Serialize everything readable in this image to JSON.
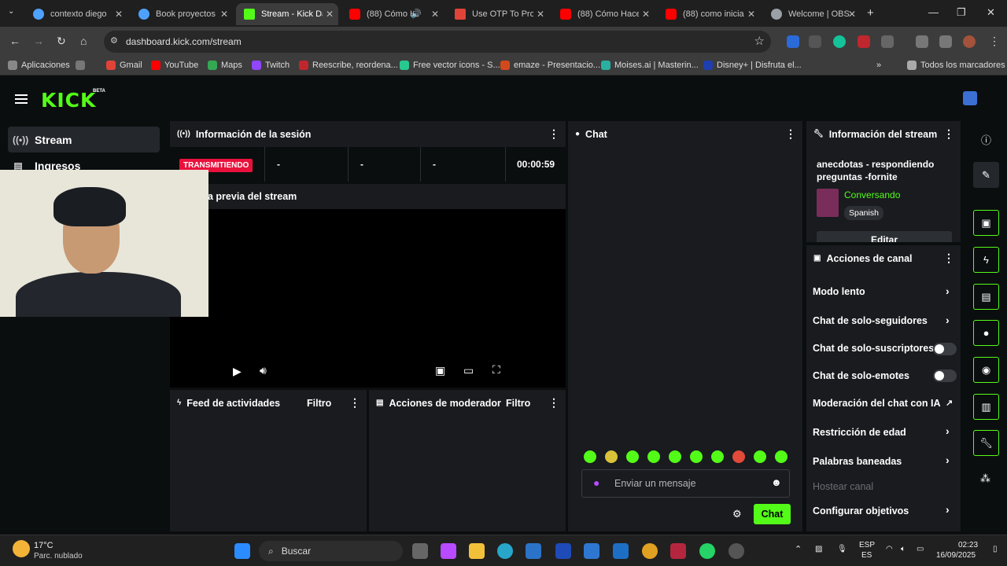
{
  "browser": {
    "tabs": [
      {
        "label": "contexto diego",
        "color": "#4ea1ff"
      },
      {
        "label": "Book proyectos",
        "color": "#4ea1ff"
      },
      {
        "label": "Stream - Kick Da",
        "color": "#53fc18"
      },
      {
        "label": "(88) Cómo H",
        "color": "#ff0000"
      },
      {
        "label": "Use OTP To Proc",
        "color": "#e04438"
      },
      {
        "label": "(88) Cómo Hace",
        "color": "#ff0000"
      },
      {
        "label": "(88) como iniciar",
        "color": "#ff0000"
      },
      {
        "label": "Welcome | OBS",
        "color": "#9aa0a6"
      }
    ],
    "url": "dashboard.kick.com/stream",
    "bookmarks": [
      {
        "label": "Aplicaciones"
      },
      {
        "label": "Gmail"
      },
      {
        "label": "YouTube"
      },
      {
        "label": "Maps"
      },
      {
        "label": "Twitch"
      },
      {
        "label": "Reescribe, reordena..."
      },
      {
        "label": "Free vector icons - S..."
      },
      {
        "label": "emaze - Presentacio..."
      },
      {
        "label": "Moises.ai | Masterin..."
      },
      {
        "label": "Disney+ | Disfruta el..."
      }
    ],
    "all_bookmarks": "Todos los marcadores"
  },
  "app": {
    "logo": "KICK",
    "beta": "BETA",
    "sidebar": [
      {
        "label": "Stream"
      },
      {
        "label": "Ingresos"
      }
    ],
    "session": {
      "title": "Información de la sesión",
      "badge": "TRANSMITIENDO",
      "stat1": "-",
      "stat2": "-",
      "stat3": "-",
      "time": "00:00:59"
    },
    "preview_title": "a previa del stream",
    "feed": {
      "title": "Feed de actividades",
      "filter": "Filtro"
    },
    "modactions": {
      "title": "Acciones de moderador",
      "filter": "Filtro"
    },
    "chat": {
      "title": "Chat",
      "placeholder": "Enviar un mensaje",
      "button": "Chat"
    },
    "stream_info": {
      "title": "Información del stream",
      "stream_title": "anecdotas - respondiendo preguntas -fornite",
      "category": "Conversando",
      "language": "Spanish",
      "edit": "Editar"
    },
    "channel_actions": {
      "title": "Acciones de canal",
      "items": [
        {
          "label": "Modo lento"
        },
        {
          "label": "Chat de solo-seguidores"
        },
        {
          "label": "Chat de solo-suscriptores"
        },
        {
          "label": "Chat de solo-emotes"
        },
        {
          "label": "Moderación del chat con IA"
        },
        {
          "label": "Restricción de edad"
        },
        {
          "label": "Palabras baneadas"
        },
        {
          "label": "Hostear canal"
        },
        {
          "label": "Configurar objetivos"
        }
      ]
    }
  },
  "taskbar": {
    "weather_temp": "17°C",
    "weather_desc": "Parc. nublado",
    "search": "Buscar",
    "lang1": "ESP",
    "lang2": "ES",
    "time": "02:23",
    "date": "16/09/2025"
  },
  "colors": {
    "accent": "#53fc18",
    "live": "#e9113c"
  }
}
